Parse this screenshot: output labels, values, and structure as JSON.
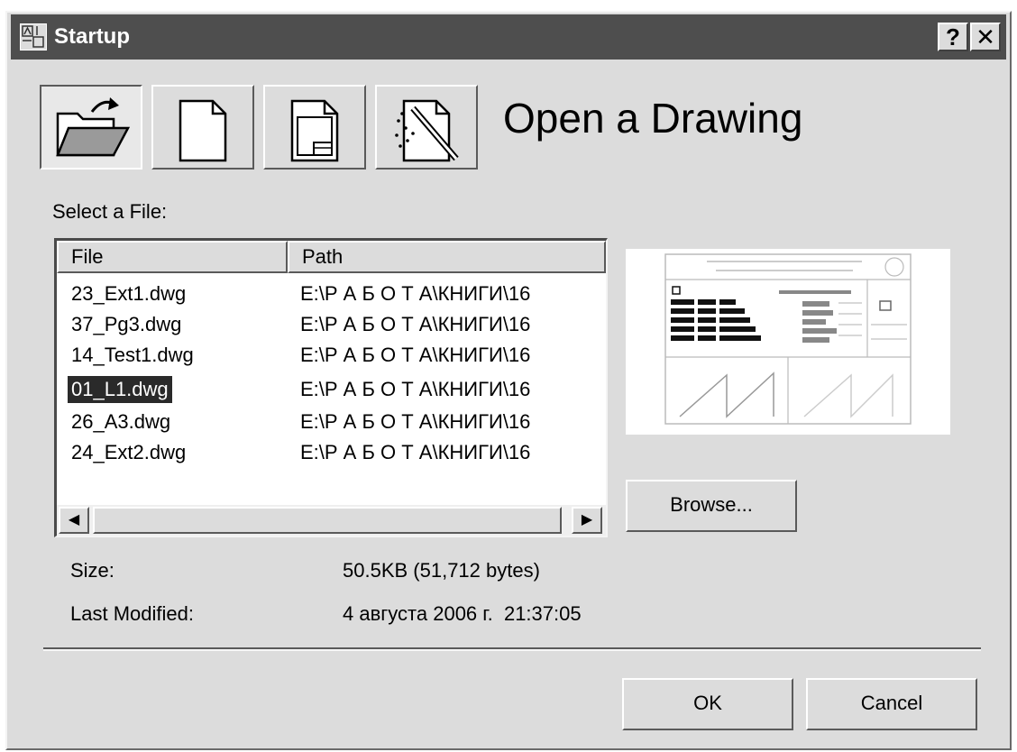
{
  "window": {
    "title": "Startup",
    "help_button": "?",
    "close_button": "✕"
  },
  "toolbar": {
    "buttons": [
      {
        "name": "open-drawing",
        "icon": "open-folder-icon",
        "active": true
      },
      {
        "name": "start-from-scratch",
        "icon": "blank-page-icon",
        "active": false
      },
      {
        "name": "use-template",
        "icon": "template-page-icon",
        "active": false
      },
      {
        "name": "use-wizard",
        "icon": "wizard-wand-icon",
        "active": false
      }
    ],
    "heading": "Open a Drawing"
  },
  "file_list": {
    "label": "Select a File:",
    "columns": [
      "File",
      "Path"
    ],
    "rows": [
      {
        "file": "23_Ext1.dwg",
        "path": "E:\\Р А Б О Т А\\КНИГИ\\16"
      },
      {
        "file": "37_Pg3.dwg",
        "path": "E:\\Р А Б О Т А\\КНИГИ\\16"
      },
      {
        "file": "14_Test1.dwg",
        "path": "E:\\Р А Б О Т А\\КНИГИ\\16"
      },
      {
        "file": "01_L1.dwg",
        "path": "E:\\Р А Б О Т А\\КНИГИ\\16",
        "selected": true
      },
      {
        "file": "26_A3.dwg",
        "path": "E:\\Р А Б О Т А\\КНИГИ\\16"
      },
      {
        "file": "24_Ext2.dwg",
        "path": "E:\\Р А Б О Т А\\КНИГИ\\16"
      }
    ],
    "scroll_left": "◀",
    "scroll_right": "▶"
  },
  "browse_label": "Browse...",
  "info": {
    "size_label": "Size:",
    "size_value": "50.5KB (51,712 bytes)",
    "modified_label": "Last Modified:",
    "modified_value": "4 августа 2006 г.  21:37:05"
  },
  "footer": {
    "ok_label": "OK",
    "cancel_label": "Cancel"
  },
  "colors": {
    "dialog_bg": "#dcdcdc",
    "titlebar_bg": "#4e4e4e",
    "selection_bg": "#2a2a2a"
  }
}
